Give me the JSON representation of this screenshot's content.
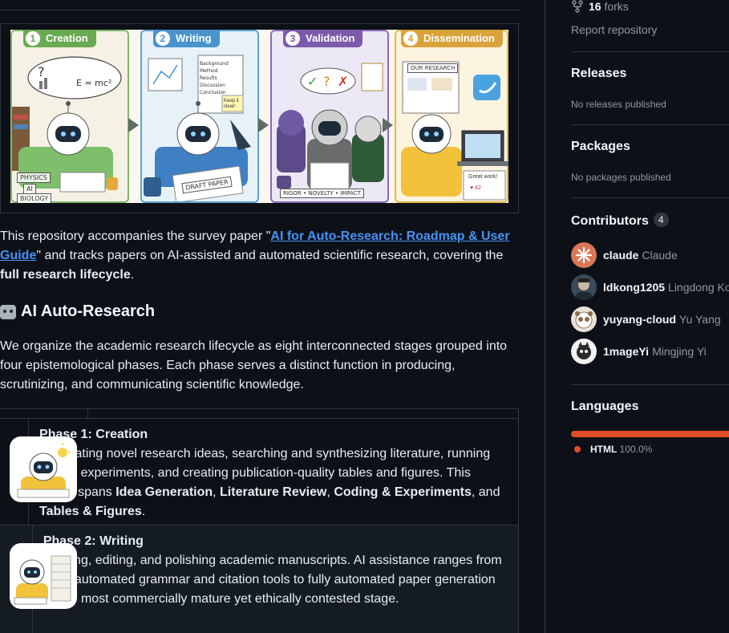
{
  "hero": {
    "panels": [
      {
        "num": "1",
        "label": "Creation"
      },
      {
        "num": "2",
        "label": "Writing"
      },
      {
        "num": "3",
        "label": "Validation"
      },
      {
        "num": "4",
        "label": "Dissemination"
      }
    ],
    "tags": {
      "physics": "PHYSICS",
      "ai": "AI",
      "biology": "BIOLOGY",
      "formula": "E = mc²",
      "draft": "DRAFT PAPER",
      "rigor": "RIGOR • NOVELTY • IMPACT",
      "our_research": "OUR RESEARCH",
      "great": "Great work!",
      "likes": "♥ 42",
      "keep_it_clear": "Keep it clear!",
      "checklist": [
        "Background",
        "Method",
        "Results",
        "Discussion",
        "Conclusion"
      ]
    }
  },
  "intro": {
    "before": "This repository accompanies the survey paper \"",
    "link": "AI for Auto-Research: Roadmap & User Guide",
    "middle": "\" and tracks papers on AI-assisted and automated scientific research, covering the ",
    "bold": "full research lifecycle",
    "after": "."
  },
  "section": {
    "title": "AI Auto-Research",
    "description": "We organize the academic research lifecycle as eight interconnected stages grouped into four epistemological phases. Each phase serves a distinct function in producing, scrutinizing, and communicating scientific knowledge."
  },
  "phases": [
    {
      "title": "Phase 1: Creation",
      "text1": "Generating novel research ideas, searching and synthesizing literature, running coding experiments, and creating publication-quality tables and figures. This phase spans ",
      "b1": "Idea Generation",
      "sep1": ", ",
      "b2": "Literature Review",
      "sep2": ", ",
      "b3": "Coding & Experiments",
      "sep3": ", and ",
      "b4": "Tables & Figures",
      "end": "."
    },
    {
      "title": "Phase 2: Writing",
      "text": "Drafting, editing, and polishing academic manuscripts. AI assistance ranges from semi-automated grammar and citation tools to fully automated paper generation — the most commercially mature yet ethically contested stage."
    }
  ],
  "sidebar": {
    "forks_count": "16",
    "forks_label": "forks",
    "report": "Report repository",
    "releases": {
      "title": "Releases",
      "empty": "No releases published"
    },
    "packages": {
      "title": "Packages",
      "empty": "No packages published"
    },
    "contributors": {
      "title": "Contributors",
      "count": "4",
      "people": [
        {
          "login": "claude",
          "name": "Claude"
        },
        {
          "login": "ldkong1205",
          "name": "Lingdong Kong"
        },
        {
          "login": "yuyang-cloud",
          "name": "Yu Yang"
        },
        {
          "login": "1mageYi",
          "name": "Mingjing Yi"
        }
      ]
    },
    "languages": {
      "title": "Languages",
      "items": [
        {
          "name": "HTML",
          "percent": "100.0%",
          "color": "#e34c26"
        }
      ]
    }
  }
}
